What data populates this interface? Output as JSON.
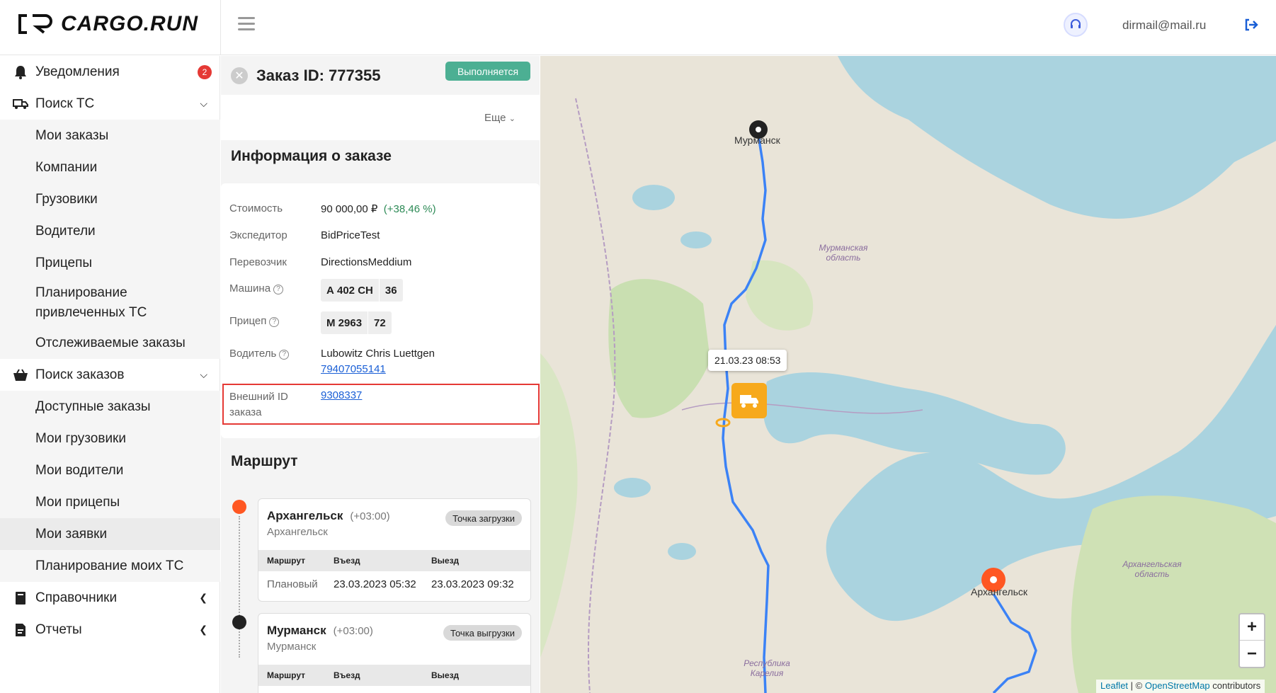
{
  "app": {
    "logo_text": "CARGO.RUN"
  },
  "header": {
    "email": "dirmail@mail.ru"
  },
  "sidebar": {
    "notifications": {
      "label": "Уведомления",
      "badge": "2"
    },
    "search_vehicles": {
      "label": "Поиск ТС"
    },
    "sub1": [
      "Мои заказы",
      "Компании",
      "Грузовики",
      "Водители",
      "Прицепы",
      "Планирование привлеченных ТС",
      "Отслеживаемые заказы"
    ],
    "search_orders": {
      "label": "Поиск заказов"
    },
    "sub2": [
      "Доступные заказы",
      "Мои грузовики",
      "Мои водители",
      "Мои прицепы",
      "Мои заявки",
      "Планирование моих ТС"
    ],
    "references": {
      "label": "Справочники"
    },
    "reports": {
      "label": "Отчеты"
    }
  },
  "order": {
    "title": "Заказ ID: 777355",
    "status": "Выполняется",
    "more": "Еще",
    "info_heading": "Информация о заказе",
    "cost_label": "Стоимость",
    "cost_value": "90 000,00 ₽",
    "cost_delta": "(+38,46 %)",
    "forwarder_label": "Экспедитор",
    "forwarder_value": "BidPriceTest",
    "carrier_label": "Перевозчик",
    "carrier_value": "DirectionsMeddium",
    "vehicle_label": "Машина",
    "vehicle_plate": "А 402 СН",
    "vehicle_region": "36",
    "trailer_label": "Прицеп",
    "trailer_plate": "М 2963",
    "trailer_region": "72",
    "driver_label": "Водитель",
    "driver_name": "Lubowitz Chris Luettgen",
    "driver_phone": "79407055141",
    "external_id_label": "Внешний ID заказа",
    "external_id_value": "9308337",
    "route_heading": "Маршрут"
  },
  "route": {
    "columns": [
      "Маршрут",
      "Въезд",
      "Выезд"
    ],
    "points": [
      {
        "city": "Архангельск",
        "tz": "(+03:00)",
        "sub": "Архангельск",
        "tag": "Точка загрузки",
        "row_type": "Плановый",
        "in": "23.03.2023 05:32",
        "out": "23.03.2023 09:32"
      },
      {
        "city": "Мурманск",
        "tz": "(+03:00)",
        "sub": "Мурманск",
        "tag": "Точка выгрузки"
      }
    ]
  },
  "map": {
    "tooltip": "21.03.23 08:53",
    "city_murmansk": "Мурманск",
    "city_arkhangelsk": "Архангельск",
    "region_murmansk": "Мурманская область",
    "region_arkhangelsk": "Архангельская область",
    "region_karelia": "Республика Карелия",
    "attr_leaflet": "Leaflet",
    "attr_sep": "| ©",
    "attr_osm": "OpenStreetMap",
    "attr_contrib": "contributors",
    "zoom_in": "+",
    "zoom_out": "−"
  },
  "colors": {
    "status": "#4caf93",
    "accent": "#1a5fd6",
    "alert": "#e53935",
    "route_line": "#3b82f6",
    "truck": "#f7a91c"
  }
}
